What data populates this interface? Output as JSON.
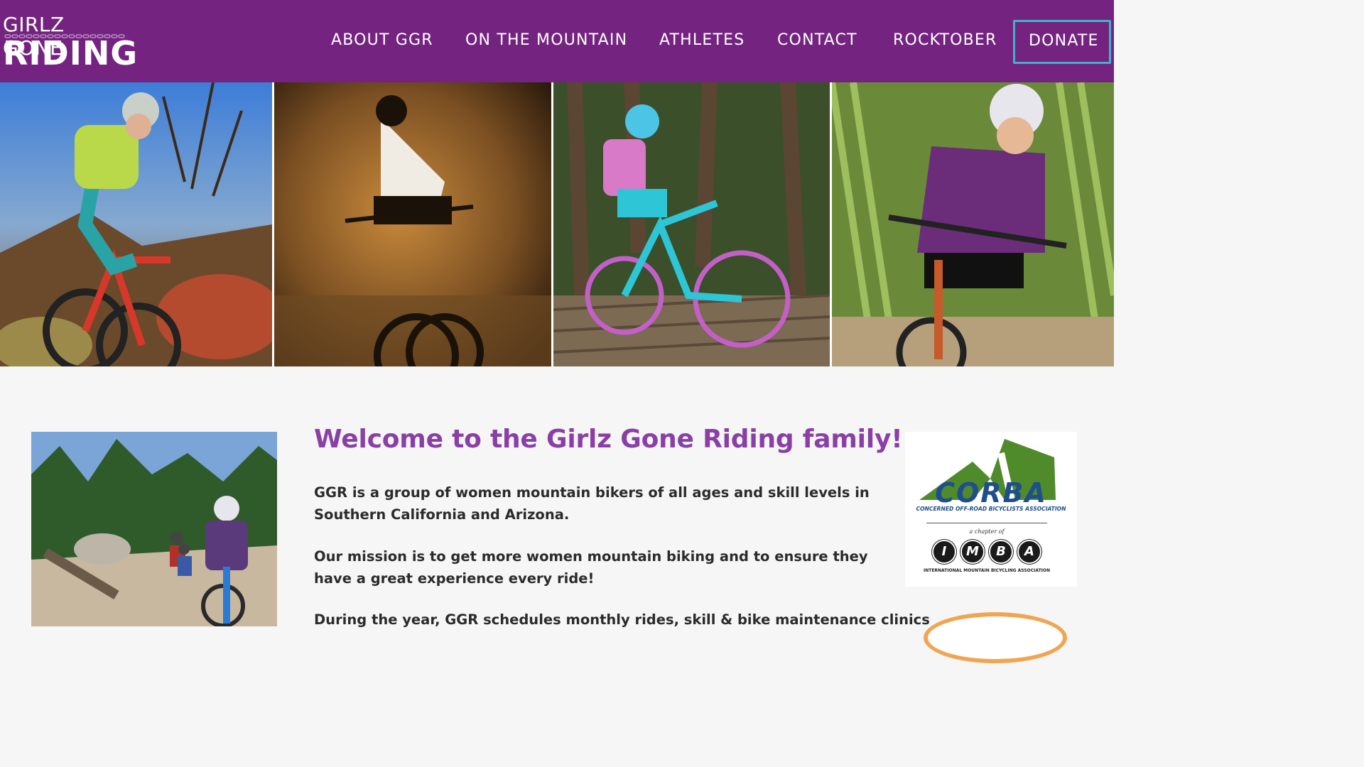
{
  "logo": {
    "line1": "GIRLZ GONE",
    "line2": "RIDING"
  },
  "nav": {
    "items": [
      {
        "label": "ABOUT GGR"
      },
      {
        "label": "ON THE MOUNTAIN"
      },
      {
        "label": "ATHLETES"
      },
      {
        "label": "CONTACT"
      },
      {
        "label": "ROCKTOBER"
      }
    ],
    "donate": "DONATE"
  },
  "hero": {
    "photos": [
      "rider-red-bike-rocks",
      "rider-golden-light",
      "rider-teal-bike-bridge",
      "rider-purple-jersey-forest"
    ]
  },
  "main": {
    "headline": "Welcome to the Girlz Gone Riding family!",
    "paragraphs": [
      "GGR is a group of women mountain bikers of all ages and skill levels in Southern California and Arizona.",
      "Our mission is to get more women mountain biking and to ensure they have a great experience every ride!",
      "During the year, GGR schedules monthly rides, skill & bike maintenance clinics"
    ]
  },
  "sponsor": {
    "corba_name": "CORBA",
    "corba_tagline": "CONCERNED OFF-ROAD BICYCLISTS ASSOCIATION",
    "chapter_of": "a chapter of",
    "imba_letters": [
      "I",
      "M",
      "B",
      "A"
    ],
    "imba_tagline": "INTERNATIONAL MOUNTAIN BICYCLING ASSOCIATION"
  },
  "colors": {
    "header_bg": "#742480",
    "headline": "#8a3fa7",
    "donate_border": "#3fb3c9",
    "corba_green": "#4f8a2b",
    "corba_blue": "#1f4e8c"
  }
}
